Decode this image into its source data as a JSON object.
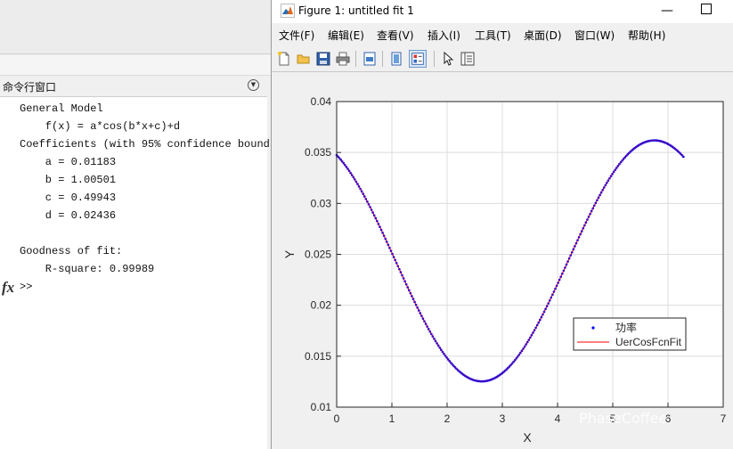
{
  "command_window": {
    "title": "命令行窗口",
    "lines": [
      "General Model",
      "    f(x) = a*cos(b*x+c)+d",
      "Coefficients (with 95% confidence bounds",
      "    a = 0.01183",
      "    b = 1.00501",
      "    c = 0.49943",
      "    d = 0.02436",
      "",
      "Goodness of fit:",
      "    R-square: 0.99989"
    ],
    "fx_label": "fx",
    "prompt": ">>"
  },
  "figure": {
    "title": "Figure 1: untitled fit 1",
    "minimize_label": "—",
    "menu": [
      "文件(F)",
      "编辑(E)",
      "查看(V)",
      "插入(I)",
      "工具(T)",
      "桌面(D)",
      "窗口(W)",
      "帮助(H)"
    ],
    "toolbar": [
      "new-file",
      "open-file",
      "save",
      "print",
      "print-preview",
      "plot-tools-hide",
      "plot-tools-show",
      "edit-plot",
      "property-editor"
    ]
  },
  "watermark": "PhaseCoffee",
  "chart_data": {
    "type": "line",
    "xlabel": "X",
    "ylabel": "Y",
    "xlim": [
      0,
      7
    ],
    "ylim": [
      0.01,
      0.04
    ],
    "xticks": [
      "0",
      "1",
      "2",
      "3",
      "4",
      "5",
      "6",
      "7"
    ],
    "yticks": [
      "0.01",
      "0.015",
      "0.02",
      "0.025",
      "0.03",
      "0.035",
      "0.04"
    ],
    "grid": true,
    "legend_position": "lower-right",
    "series": [
      {
        "name": "功率",
        "style": "points",
        "color": "#0000ff",
        "model": {
          "a": 0.01183,
          "b": 1.00501,
          "c": 0.49943,
          "d": 0.02436
        },
        "x_range": [
          0,
          6.28
        ],
        "n_points": 250
      },
      {
        "name": "UerCosFcnFit",
        "style": "line",
        "color": "#ff0000",
        "model": {
          "a": 0.01183,
          "b": 1.00501,
          "c": 0.49943,
          "d": 0.02436
        },
        "x_range": [
          0,
          6.28
        ]
      }
    ]
  }
}
